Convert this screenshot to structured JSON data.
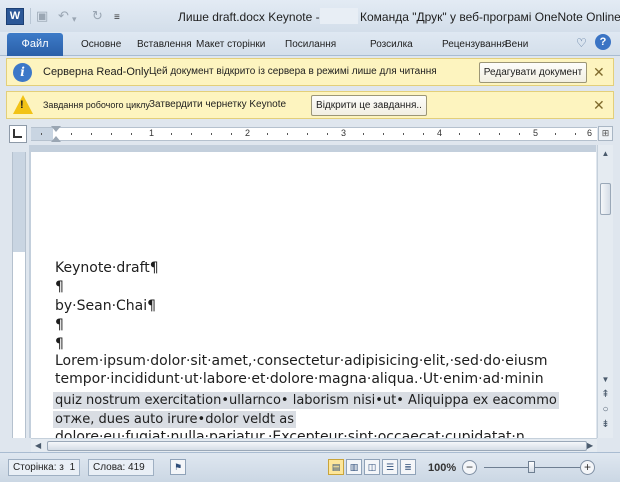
{
  "titlebar": {
    "title_doc": "Лише draft.docx Keynote -",
    "title_app": "Команда \"Друк\" у веб-програмі OneNote Online",
    "app_icon": "W"
  },
  "ribbon": {
    "file_tab": "Файл",
    "tabs": [
      "Основне",
      "Вставлення",
      "Макет сторінки",
      "Посилання",
      "Розсилка",
      "Рецензування",
      "Вени"
    ]
  },
  "messages": {
    "readonly": {
      "title": "Серверна Read-Only",
      "text": "Цей документ відкрито із сервера в режимі лише для читання",
      "button": "Редагувати документ"
    },
    "workflow": {
      "title": "Завдання робочого циклу",
      "text": "Затвердити чернетку Keynote",
      "button": "Відкрити це завдання.."
    },
    "close_glyph": "✕"
  },
  "ruler": {
    "numbers": [
      "1",
      "2",
      "3",
      "4",
      "5",
      "6"
    ]
  },
  "document": {
    "lines": [
      "Keynote·draft¶",
      "¶",
      "by·Sean·Chai¶",
      "¶",
      "¶",
      "Lorem·ipsum·dolor·sit·amet,·consectetur·adipisicing·elit,·sed·do·eiusm",
      "tempor·incididunt·ut·labore·et·dolore·magna·aliqua.·Ut·enim·ad·minin"
    ],
    "highlighted_lines": [
      "quiz nostrum exercitation•ullarnco• laborism nisi•ut• Aliquippa ex eacommo",
      "отже, dues auto irure•dolor veldt as"
    ],
    "cut_line": "dolore·eu·fugiat·nulla·pariatur.·Excepteur·sint·occaecat·cupidatat·n"
  },
  "statusbar": {
    "page": "Сторінка: з",
    "page_num": "1",
    "words": "Слова: 419",
    "zoom": "100%",
    "zoom_value_percent": 100
  }
}
